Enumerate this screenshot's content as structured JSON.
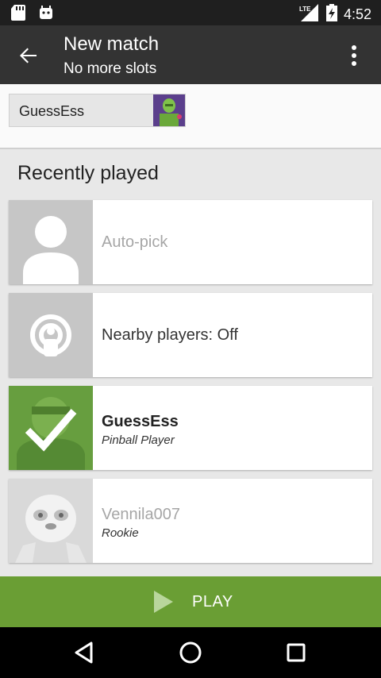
{
  "status_bar": {
    "time": "4:52",
    "network": "LTE"
  },
  "app_bar": {
    "title": "New match",
    "subtitle": "No more slots"
  },
  "slot": {
    "player_name": "GuessEss"
  },
  "section": {
    "title": "Recently played"
  },
  "list": [
    {
      "primary": "Auto-pick",
      "secondary": ""
    },
    {
      "primary": "Nearby players: Off",
      "secondary": ""
    },
    {
      "primary": "GuessEss",
      "secondary": "Pinball Player"
    },
    {
      "primary": "Vennila007",
      "secondary": "Rookie"
    }
  ],
  "play_button": {
    "label": "PLAY"
  },
  "colors": {
    "accent_green": "#6a9e34",
    "app_bar": "#333333",
    "status_bar": "#1f1f1f"
  }
}
